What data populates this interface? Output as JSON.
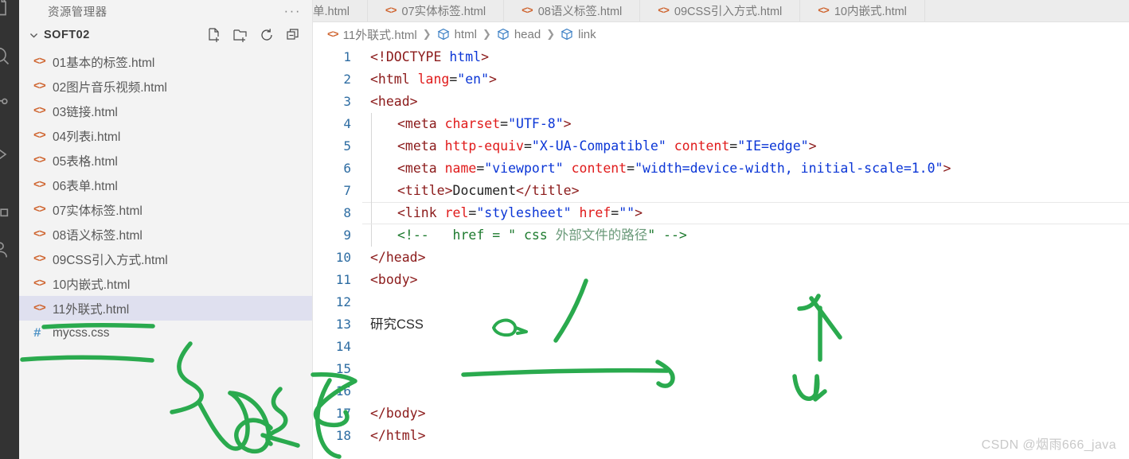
{
  "activity_bar": {
    "icons": [
      "files-icon",
      "search-icon",
      "source-control-icon",
      "run-debug-icon",
      "extensions-icon",
      "account-icon"
    ]
  },
  "sidebar": {
    "title": "资源管理器",
    "more_actions_label": "···",
    "folder": {
      "name": "SOFT02",
      "expanded": true,
      "actions": [
        {
          "name": "new-file-icon",
          "label": "新建文件"
        },
        {
          "name": "new-folder-icon",
          "label": "新建文件夹"
        },
        {
          "name": "refresh-icon",
          "label": "刷新"
        },
        {
          "name": "collapse-all-icon",
          "label": "折叠"
        }
      ]
    },
    "files": [
      {
        "name": "01基本的标签.html",
        "icon": "html-icon",
        "selected": false
      },
      {
        "name": "02图片音乐视频.html",
        "icon": "html-icon",
        "selected": false
      },
      {
        "name": "03链接.html",
        "icon": "html-icon",
        "selected": false
      },
      {
        "name": "04列表i.html",
        "icon": "html-icon",
        "selected": false
      },
      {
        "name": "05表格.html",
        "icon": "html-icon",
        "selected": false
      },
      {
        "name": "06表单.html",
        "icon": "html-icon",
        "selected": false
      },
      {
        "name": "07实体标签.html",
        "icon": "html-icon",
        "selected": false
      },
      {
        "name": "08语义标签.html",
        "icon": "html-icon",
        "selected": false
      },
      {
        "name": "09CSS引入方式.html",
        "icon": "html-icon",
        "selected": false
      },
      {
        "name": "10内嵌式.html",
        "icon": "html-icon",
        "selected": false
      },
      {
        "name": "11外联式.html",
        "icon": "html-icon",
        "selected": true
      },
      {
        "name": "mycss.css",
        "icon": "css-icon",
        "selected": false
      }
    ]
  },
  "tabs": [
    {
      "label": "单.html",
      "partial": true,
      "icon": ""
    },
    {
      "label": "07实体标签.html",
      "partial": false,
      "icon": "html-icon"
    },
    {
      "label": "08语义标签.html",
      "partial": false,
      "icon": "html-icon"
    },
    {
      "label": "09CSS引入方式.html",
      "partial": false,
      "icon": "html-icon"
    },
    {
      "label": "10内嵌式.html",
      "partial": false,
      "icon": "html-icon"
    }
  ],
  "breadcrumb": [
    {
      "label": "11外联式.html",
      "icon": "html-icon"
    },
    {
      "label": "html",
      "icon": "symbol-cube-icon"
    },
    {
      "label": "head",
      "icon": "symbol-cube-icon"
    },
    {
      "label": "link",
      "icon": "symbol-cube-icon"
    }
  ],
  "editor": {
    "active_line": 8,
    "lines": [
      {
        "n": "1",
        "indent": 0,
        "tokens": [
          {
            "c": "t-tag",
            "t": "<!DOCTYPE "
          },
          {
            "c": "t-val",
            "t": "html"
          },
          {
            "c": "t-tag",
            "t": ">"
          }
        ]
      },
      {
        "n": "2",
        "indent": 0,
        "tokens": [
          {
            "c": "t-tag",
            "t": "<html "
          },
          {
            "c": "t-attr",
            "t": "lang"
          },
          {
            "c": "t-plain",
            "t": "="
          },
          {
            "c": "t-val",
            "t": "\"en\""
          },
          {
            "c": "t-tag",
            "t": ">"
          }
        ]
      },
      {
        "n": "3",
        "indent": 0,
        "tokens": [
          {
            "c": "t-tag",
            "t": "<head>"
          }
        ]
      },
      {
        "n": "4",
        "indent": 1,
        "tokens": [
          {
            "c": "t-tag",
            "t": "<meta "
          },
          {
            "c": "t-attr",
            "t": "charset"
          },
          {
            "c": "t-plain",
            "t": "="
          },
          {
            "c": "t-val",
            "t": "\"UTF-8\""
          },
          {
            "c": "t-tag",
            "t": ">"
          }
        ]
      },
      {
        "n": "5",
        "indent": 1,
        "tokens": [
          {
            "c": "t-tag",
            "t": "<meta "
          },
          {
            "c": "t-attr",
            "t": "http-equiv"
          },
          {
            "c": "t-plain",
            "t": "="
          },
          {
            "c": "t-val",
            "t": "\"X-UA-Compatible\""
          },
          {
            "c": "t-plain",
            "t": " "
          },
          {
            "c": "t-attr",
            "t": "content"
          },
          {
            "c": "t-plain",
            "t": "="
          },
          {
            "c": "t-val",
            "t": "\"IE=edge\""
          },
          {
            "c": "t-tag",
            "t": ">"
          }
        ]
      },
      {
        "n": "6",
        "indent": 1,
        "tokens": [
          {
            "c": "t-tag",
            "t": "<meta "
          },
          {
            "c": "t-attr",
            "t": "name"
          },
          {
            "c": "t-plain",
            "t": "="
          },
          {
            "c": "t-val",
            "t": "\"viewport\""
          },
          {
            "c": "t-plain",
            "t": " "
          },
          {
            "c": "t-attr",
            "t": "content"
          },
          {
            "c": "t-plain",
            "t": "="
          },
          {
            "c": "t-val",
            "t": "\"width=device-width, initial-scale=1.0\""
          },
          {
            "c": "t-tag",
            "t": ">"
          }
        ]
      },
      {
        "n": "7",
        "indent": 1,
        "tokens": [
          {
            "c": "t-tag",
            "t": "<title>"
          },
          {
            "c": "t-plain",
            "t": "Document"
          },
          {
            "c": "t-tag",
            "t": "</title>"
          }
        ]
      },
      {
        "n": "8",
        "indent": 1,
        "tokens": [
          {
            "c": "t-tag",
            "t": "<link "
          },
          {
            "c": "t-attr",
            "t": "rel"
          },
          {
            "c": "t-plain",
            "t": "="
          },
          {
            "c": "t-val",
            "t": "\"stylesheet\""
          },
          {
            "c": "t-plain",
            "t": " "
          },
          {
            "c": "t-attr",
            "t": "href"
          },
          {
            "c": "t-plain",
            "t": "="
          },
          {
            "c": "t-val",
            "t": "\"\""
          },
          {
            "c": "t-tag",
            "t": ">"
          }
        ]
      },
      {
        "n": "9",
        "indent": 1,
        "tokens": [
          {
            "c": "t-cmt",
            "t": "<!--   href = \" css "
          },
          {
            "c": "t-cmt-cn",
            "t": "外部文件的路径"
          },
          {
            "c": "t-cmt",
            "t": "\" -->"
          }
        ]
      },
      {
        "n": "10",
        "indent": 0,
        "tokens": [
          {
            "c": "t-tag",
            "t": "</head>"
          }
        ]
      },
      {
        "n": "11",
        "indent": 0,
        "tokens": [
          {
            "c": "t-tag",
            "t": "<body>"
          }
        ]
      },
      {
        "n": "12",
        "indent": 0,
        "tokens": []
      },
      {
        "n": "13",
        "indent": 0,
        "tokens": [
          {
            "c": "t-txt",
            "t": "研究"
          },
          {
            "c": "t-txt mono",
            "t": "CSS"
          }
        ]
      },
      {
        "n": "14",
        "indent": 0,
        "tokens": []
      },
      {
        "n": "15",
        "indent": 0,
        "tokens": []
      },
      {
        "n": "16",
        "indent": 0,
        "tokens": []
      },
      {
        "n": "17",
        "indent": 0,
        "tokens": [
          {
            "c": "t-tag",
            "t": "</body>"
          }
        ]
      },
      {
        "n": "18",
        "indent": 0,
        "tokens": [
          {
            "c": "t-tag",
            "t": "</html>"
          }
        ]
      }
    ]
  },
  "annotations": {
    "ink_color": "#2aaa4e",
    "marks": [
      "underline-under-11外联式.html",
      "underline-under-mycss.css",
      "squiggle-bracket-left",
      "scribble-cluster",
      "doodle-face",
      "diagonal-stroke",
      "long-horizontal-arrow",
      "up-arrow",
      "down-arrow"
    ]
  },
  "watermark": {
    "text": "CSDN @烟雨666_java"
  },
  "colors": {
    "sidebar_bg": "#f3f3f3",
    "selection_bg": "#dfe0ef",
    "tab_bg": "#ececec",
    "html_icon": "#cf6530",
    "css_icon": "#4a90c4",
    "line_number": "#2d6ca2",
    "tag": "#8b1a1a",
    "attr": "#e01b1b",
    "value": "#0b36d6",
    "comment": "#1d7a2e",
    "ink": "#2aaa4e"
  }
}
